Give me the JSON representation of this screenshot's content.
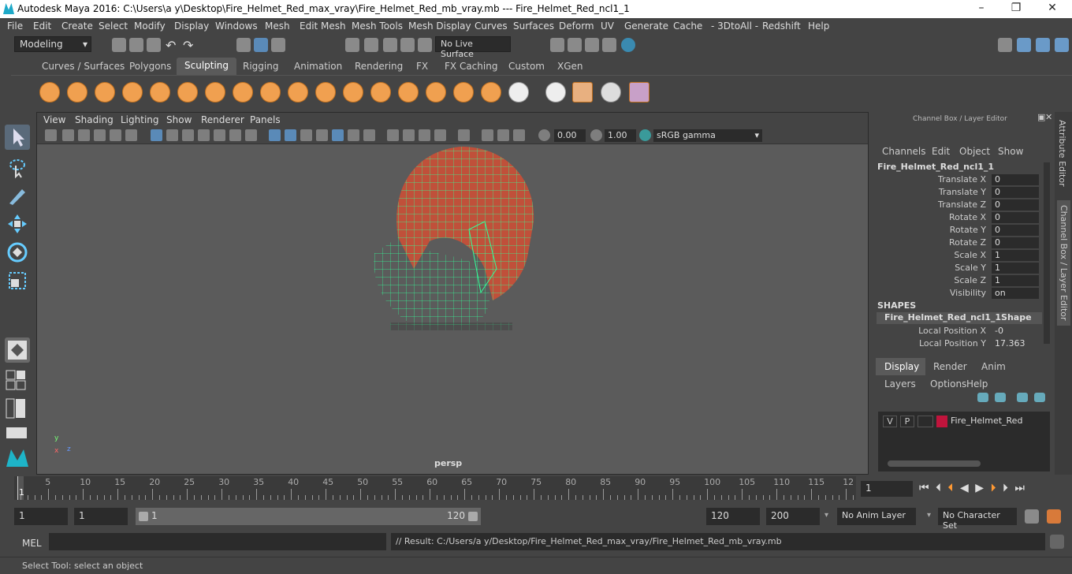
{
  "window": {
    "title": "Autodesk Maya 2016: C:\\Users\\a y\\Desktop\\Fire_Helmet_Red_max_vray\\Fire_Helmet_Red_mb_vray.mb   ---   Fire_Helmet_Red_ncl1_1",
    "minimize": "–",
    "maximize": "❐",
    "close": "✕"
  },
  "menus": [
    "File",
    "Edit",
    "Create",
    "Select",
    "Modify",
    "Display",
    "Windows",
    "Mesh",
    "Edit Mesh",
    "Mesh Tools",
    "Mesh Display",
    "Curves",
    "Surfaces",
    "Deform",
    "UV",
    "Generate",
    "Cache",
    "- 3DtoAll -",
    "Redshift",
    "Help"
  ],
  "status": {
    "mode": "Modeling",
    "live_surface": "No Live Surface"
  },
  "shelf_tabs": [
    "Curves / Surfaces",
    "Polygons",
    "Sculpting",
    "Rigging",
    "Animation",
    "Rendering",
    "FX",
    "FX Caching",
    "Custom",
    "XGen"
  ],
  "active_shelf": "Sculpting",
  "viewport": {
    "menus": [
      "View",
      "Shading",
      "Lighting",
      "Show",
      "Renderer",
      "Panels"
    ],
    "near": "0.00",
    "far": "1.00",
    "color_space": "sRGB gamma",
    "camera": "persp",
    "axis_y": "y",
    "axis_x": "x",
    "axis_z": "z"
  },
  "channel_box": {
    "title": "Channel Box / Layer Editor",
    "menus": [
      "Channels",
      "Edit",
      "Object",
      "Show"
    ],
    "object": "Fire_Helmet_Red_ncl1_1",
    "channels": [
      {
        "name": "Translate X",
        "value": "0"
      },
      {
        "name": "Translate Y",
        "value": "0"
      },
      {
        "name": "Translate Z",
        "value": "0"
      },
      {
        "name": "Rotate X",
        "value": "0"
      },
      {
        "name": "Rotate Y",
        "value": "0"
      },
      {
        "name": "Rotate Z",
        "value": "0"
      },
      {
        "name": "Scale X",
        "value": "1"
      },
      {
        "name": "Scale Y",
        "value": "1"
      },
      {
        "name": "Scale Z",
        "value": "1"
      },
      {
        "name": "Visibility",
        "value": "on"
      }
    ],
    "shapes_label": "SHAPES",
    "shape": "Fire_Helmet_Red_ncl1_1Shape",
    "shape_channels": [
      {
        "name": "Local Position X",
        "value": "-0"
      },
      {
        "name": "Local Position Y",
        "value": "17.363"
      }
    ]
  },
  "layer_editor": {
    "tabs": [
      "Display",
      "Render",
      "Anim"
    ],
    "menus": [
      "Layers",
      "Options",
      "Help"
    ],
    "layer": {
      "v": "V",
      "p": "P",
      "name": "Fire_Helmet_Red",
      "color": "#c0143c"
    }
  },
  "side_tabs": [
    "Attribute Editor",
    "Channel Box / Layer Editor"
  ],
  "timeline": {
    "ticks": [
      "5",
      "10",
      "15",
      "20",
      "25",
      "30",
      "35",
      "40",
      "45",
      "50",
      "55",
      "60",
      "65",
      "70",
      "75",
      "80",
      "85",
      "90",
      "95",
      "100",
      "105",
      "110",
      "115",
      "12"
    ],
    "start_marker": "1",
    "current": "1"
  },
  "range": {
    "start": "1",
    "playback_start": "1",
    "slider_start": "1",
    "slider_end": "120",
    "playback_end": "120",
    "end": "200",
    "anim_layer": "No Anim Layer",
    "char_set": "No Character Set"
  },
  "command": {
    "lang": "MEL",
    "result": "// Result: C:/Users/a y/Desktop/Fire_Helmet_Red_max_vray/Fire_Helmet_Red_mb_vray.mb"
  },
  "help_line": "Select Tool: select an object"
}
